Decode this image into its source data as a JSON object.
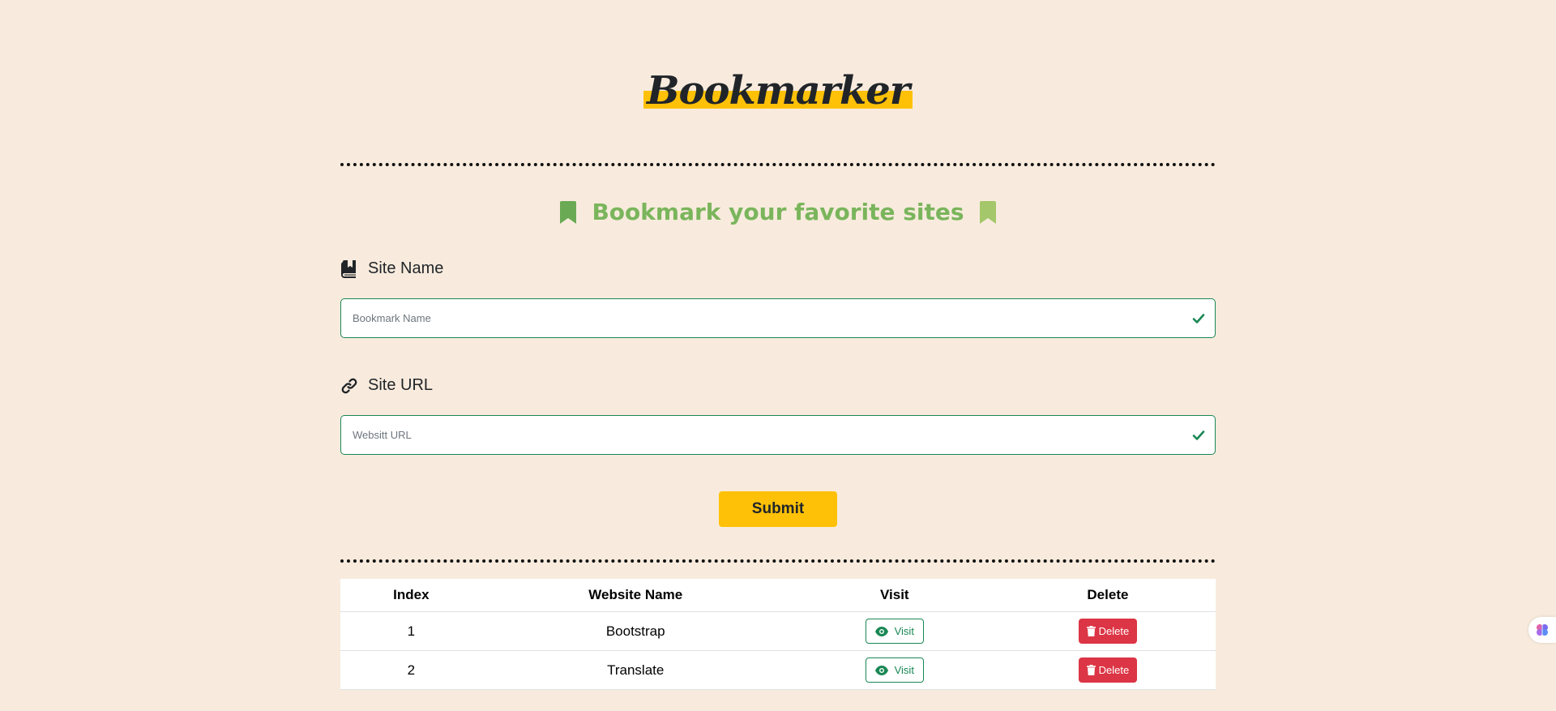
{
  "header": {
    "title": "Bookmarker",
    "subtitle": "Bookmark your favorite sites"
  },
  "form": {
    "site_name_label": "Site Name",
    "site_name_placeholder": "Bookmark Name",
    "site_url_label": "Site URL",
    "site_url_placeholder": "Websitt URL",
    "submit_label": "Submit"
  },
  "table": {
    "headers": [
      "Index",
      "Website Name",
      "Visit",
      "Delete"
    ],
    "rows": [
      {
        "index": "1",
        "name": "Bootstrap",
        "visit_label": "Visit",
        "delete_label": "Delete"
      },
      {
        "index": "2",
        "name": "Translate",
        "visit_label": "Visit",
        "delete_label": "Delete"
      }
    ]
  },
  "icons": {
    "subtitle_left": "bookmark-icon",
    "subtitle_right": "bookmark-icon",
    "site_name": "book-bookmark-icon",
    "site_url": "link-icon",
    "valid": "check-icon",
    "visit": "eye-icon",
    "delete": "trash-icon",
    "side_widget": "brain-icon"
  },
  "colors": {
    "background": "#f8ebdd",
    "accent": "#ffc107",
    "subtitle": "#7ab55c",
    "success": "#198754",
    "danger": "#dc3545"
  }
}
